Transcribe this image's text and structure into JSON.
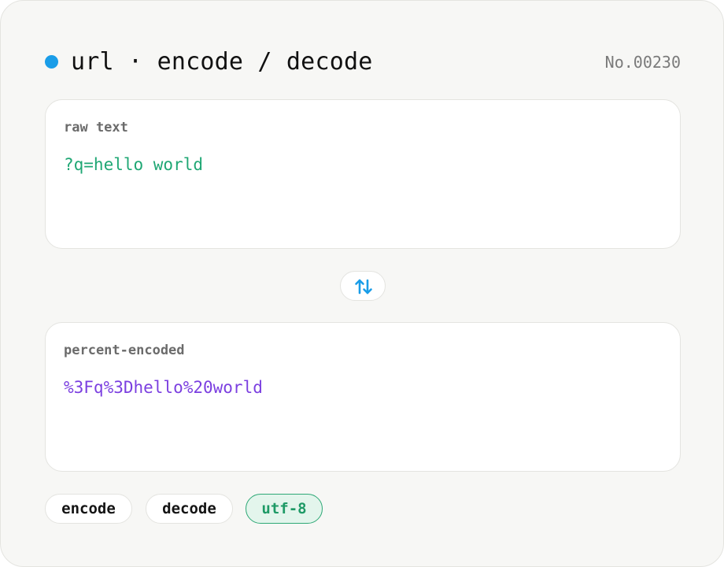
{
  "header": {
    "title": "url · encode / decode",
    "serial": "No.00230",
    "accent_color": "#1a9de8"
  },
  "raw_panel": {
    "label": "raw text",
    "value": "?q=hello world",
    "value_color": "#1fa774"
  },
  "swap": {
    "icon": "swap-vertical-arrows-icon"
  },
  "encoded_panel": {
    "label": "percent-encoded",
    "value": "%3Fq%3Dhello%20world",
    "value_color": "#7b3fe0"
  },
  "chips": {
    "encode": "encode",
    "decode": "decode",
    "charset": "utf-8",
    "charset_selected": true
  }
}
